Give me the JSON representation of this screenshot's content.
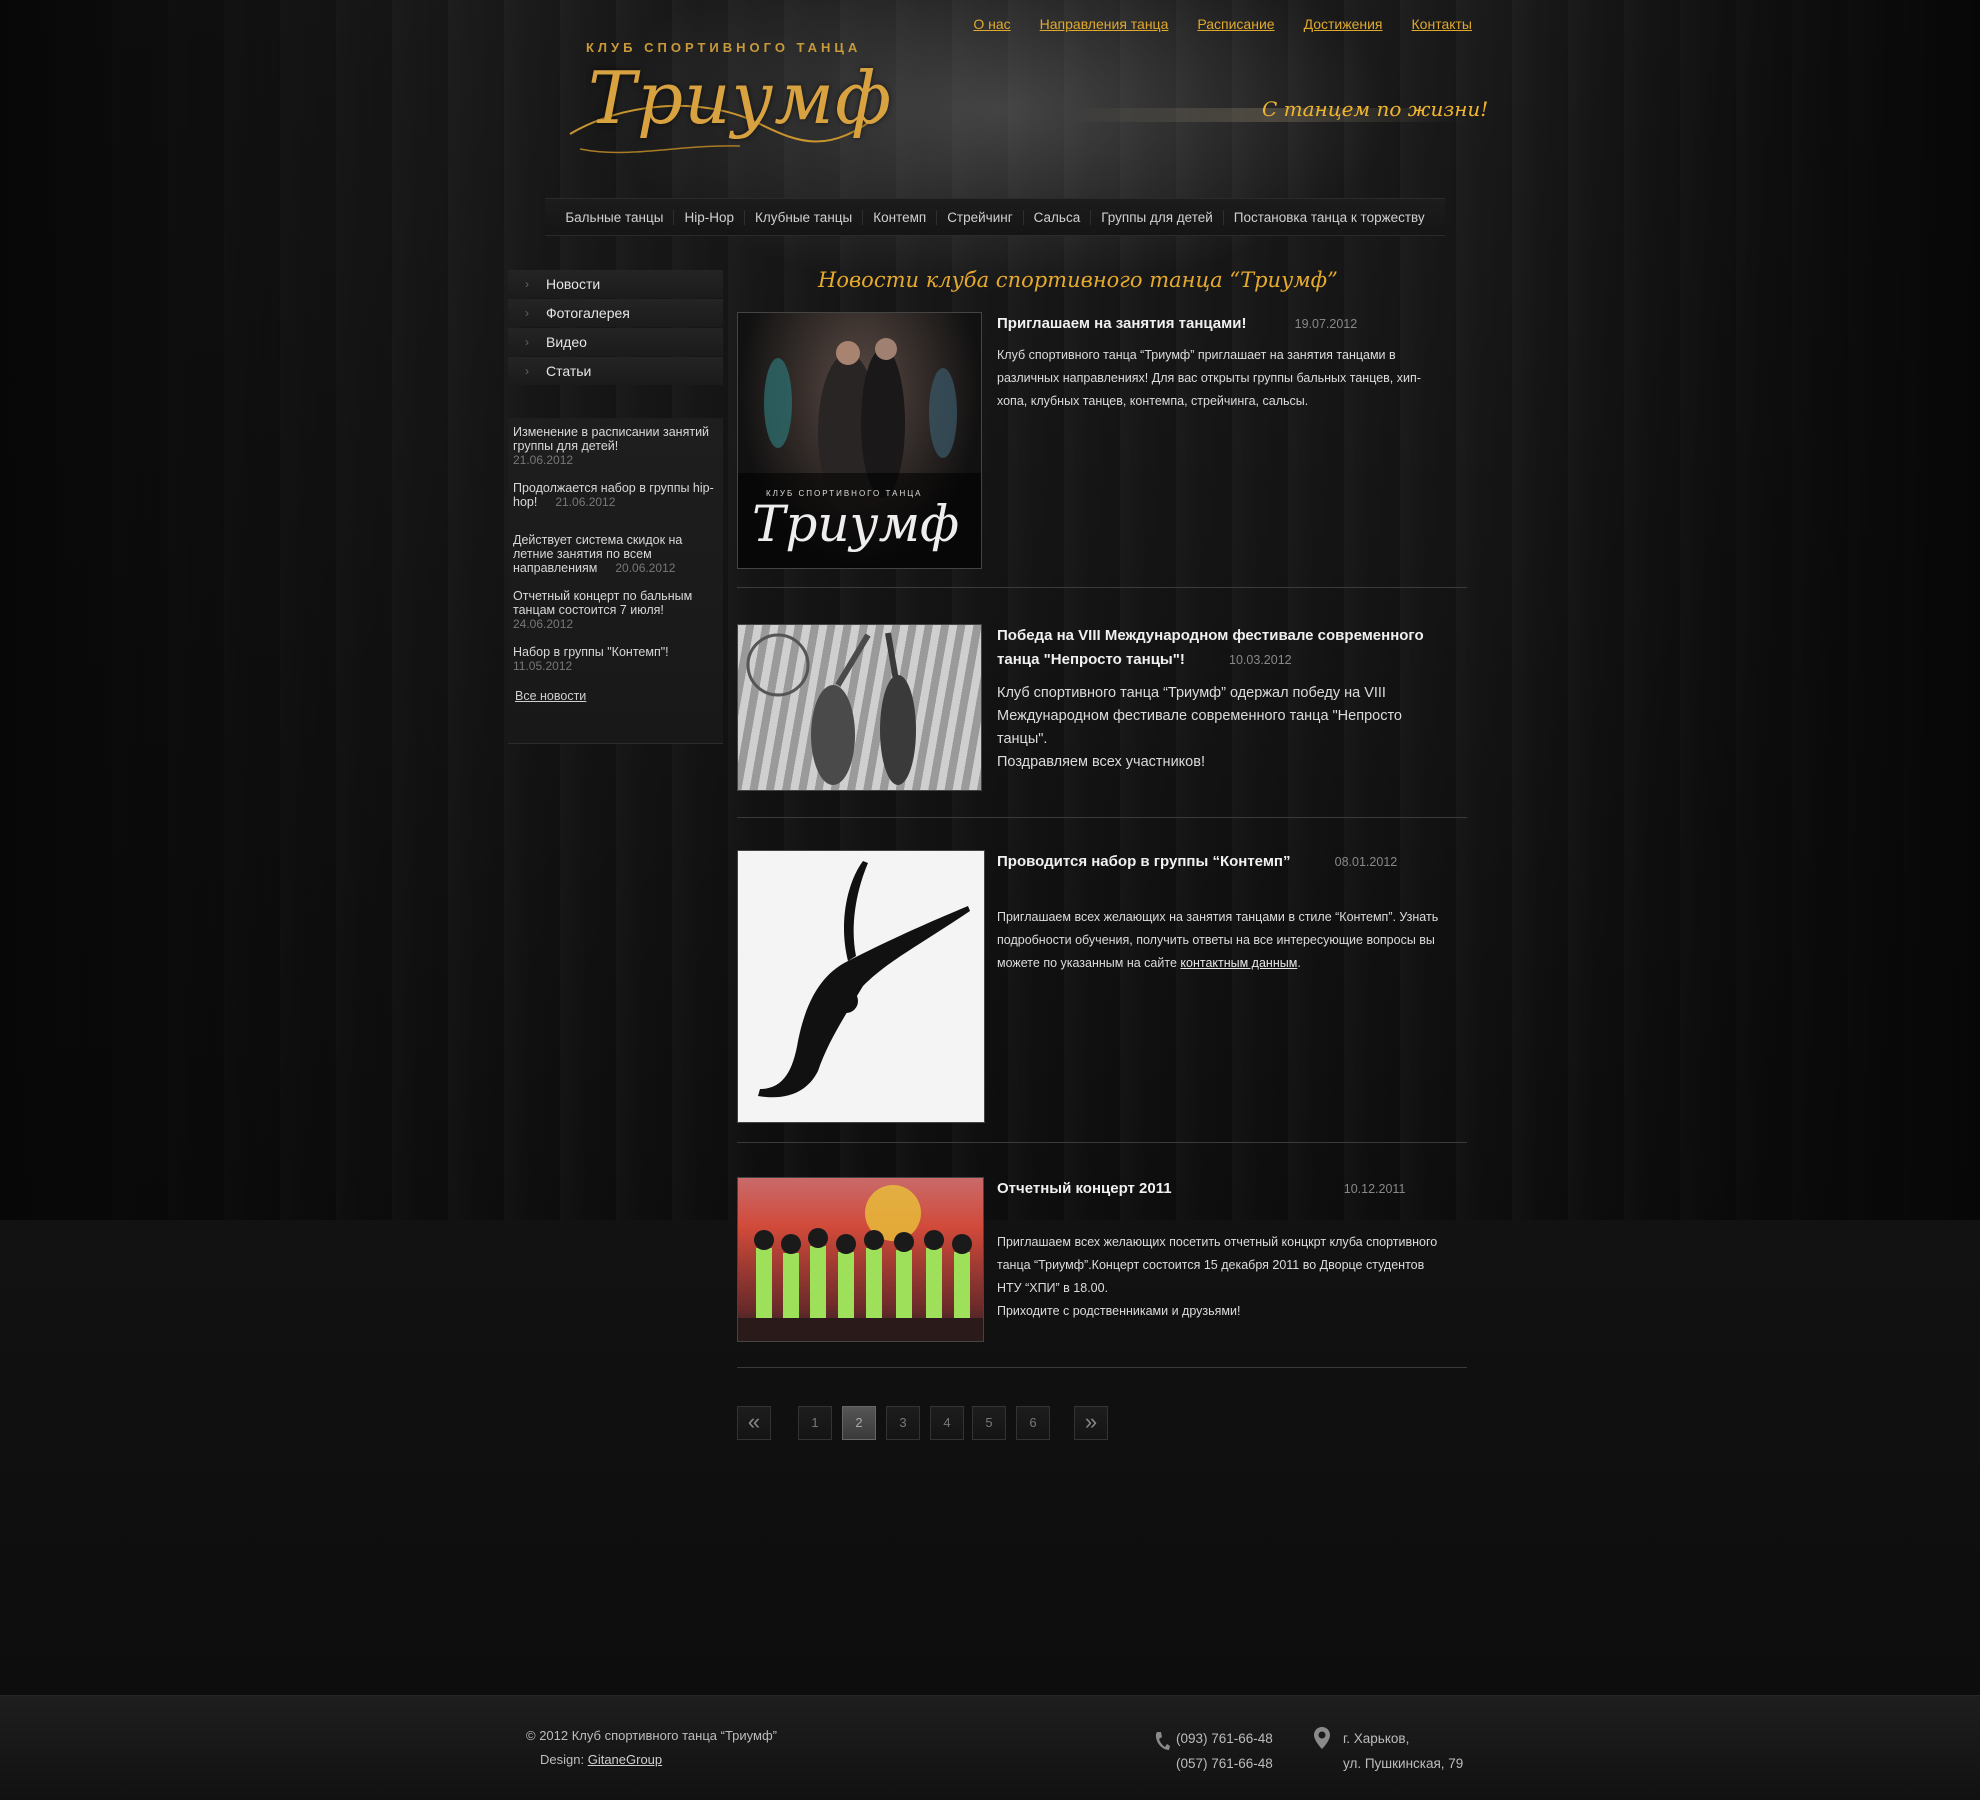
{
  "header": {
    "logo_sub": "КЛУБ СПОРТИВНОГО ТАНЦА",
    "logo_main": "Триумф",
    "slogan": "С танцем по жизни!",
    "topnav": [
      "О нас",
      "Направления танца",
      "Расписание",
      "Достижения",
      "Контакты"
    ]
  },
  "categories": [
    "Бальные танцы",
    "Hip-Hop",
    "Клубные танцы",
    "Контемп",
    "Стрейчинг",
    "Сальса",
    "Группы для детей",
    "Постановка танца к торжеству"
  ],
  "sidebar": {
    "menu": [
      "Новости",
      "Фотогалерея",
      "Видео",
      "Статьи"
    ],
    "news": [
      {
        "text": "Изменение в расписании занятий группы для детей!",
        "date": "21.06.2012"
      },
      {
        "text": "Продолжается набор в группы hip-hop!",
        "date": "21.06.2012"
      },
      {
        "text": "Действует система скидок на летние занятия по всем направлениям",
        "date": "20.06.2012"
      },
      {
        "text": "Отчетный концерт по бальным танцам состоится 7 июля!",
        "date": "24.06.2012"
      },
      {
        "text": "Набор в группы \"Контемп\"!",
        "date": "11.05.2012"
      }
    ],
    "all_news": "Все новости"
  },
  "main": {
    "title": "Новости клуба спортивного танца “Триумф”",
    "articles": [
      {
        "title": "Приглашаем на занятия танцами!",
        "date": "19.07.2012",
        "text": "Клуб спортивного танца “Триумф” приглашает на занятия танцами в различных направлениях! Для вас открыты группы бальных танцев, хип-хопа, клубных танцев, контемпа, стрейчинга, сальсы.",
        "photo_caption": "Триумф",
        "photo_caption_sub": "КЛУБ СПОРТИВНОГО ТАНЦА"
      },
      {
        "title": "Победа на VIII Международном фестивале современного танца \"Непросто танцы\"!",
        "date": "10.03.2012",
        "text": "Клуб спортивного танца “Триумф” одержал победу на VIII Международном фестивале современного танца \"Непросто танцы\".",
        "text2": "Поздравляем всех участников!"
      },
      {
        "title": "Проводится набор в группы “Контемп”",
        "date": "08.01.2012",
        "text": "Приглашаем всех желающих на занятия танцами в стиле “Контемп”. Узнать подробности обучения, получить ответы на все интересующие вопросы вы можете по указанным на сайте",
        "link": "контактным данным",
        "tail": "."
      },
      {
        "title": "Отчетный концерт 2011",
        "date": "10.12.2011",
        "text": "Приглашаем всех желающих посетить отчетный концкрт клуба спортивного танца “Триумф”.Концерт состоится 15 декабря 2011 во Дворце студентов НТУ “ХПИ” в 18.00.",
        "text2": "Приходите с  родственниками и друзьями!"
      }
    ]
  },
  "pager": {
    "prev": "«",
    "next": "»",
    "pages": [
      "1",
      "2",
      "3",
      "4",
      "5",
      "6"
    ],
    "current": "2"
  },
  "footer": {
    "copyright": "©  2012 Клуб спортивного танца “Триумф”",
    "design_label": "Design:",
    "design_link": "GitaneGroup",
    "phones": [
      "(093) 761-66-48",
      "(057) 761-66-48"
    ],
    "address": [
      "г. Харьков,",
      "ул. Пушкинская, 79"
    ]
  },
  "colors": {
    "accent": "#e5aa2d",
    "background": "#0b0b0b"
  }
}
